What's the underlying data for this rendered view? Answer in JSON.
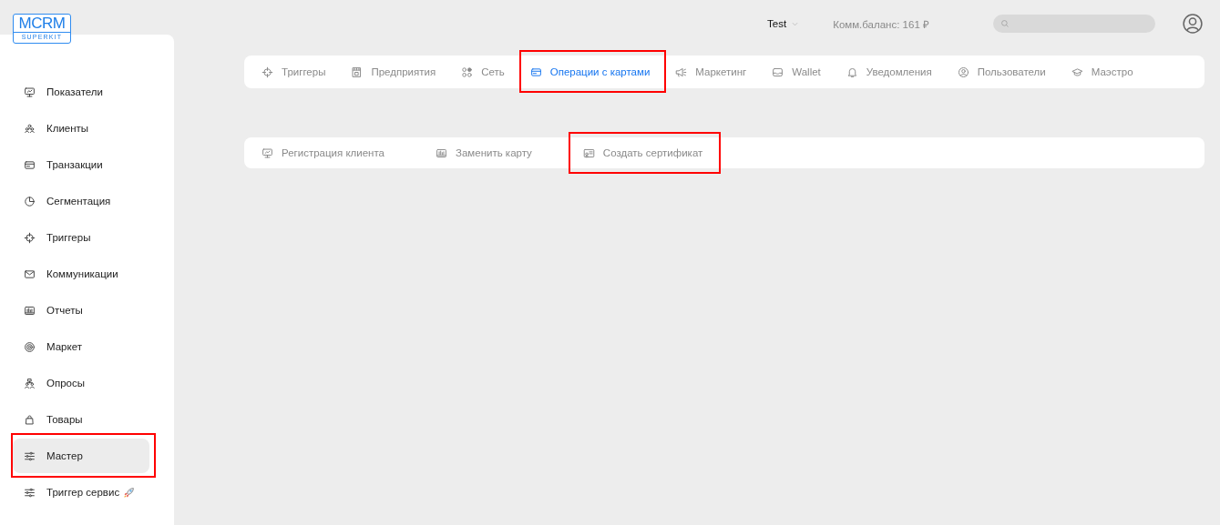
{
  "logo": {
    "title": "MCRM",
    "subtitle": "SUPERKIT"
  },
  "header": {
    "account": "Test",
    "balance": "Комм.баланс: 161 ₽"
  },
  "sidebar": {
    "items": [
      {
        "label": "Показатели",
        "selected": false,
        "highlighted": false
      },
      {
        "label": "Клиенты",
        "selected": false,
        "highlighted": false
      },
      {
        "label": "Транзакции",
        "selected": false,
        "highlighted": false
      },
      {
        "label": "Сегментация",
        "selected": false,
        "highlighted": false
      },
      {
        "label": "Триггеры",
        "selected": false,
        "highlighted": false
      },
      {
        "label": "Коммуникации",
        "selected": false,
        "highlighted": false
      },
      {
        "label": "Отчеты",
        "selected": false,
        "highlighted": false
      },
      {
        "label": "Маркет",
        "selected": false,
        "highlighted": false
      },
      {
        "label": "Опросы",
        "selected": false,
        "highlighted": false
      },
      {
        "label": "Товары",
        "selected": false,
        "highlighted": false
      },
      {
        "label": "Мастер",
        "selected": true,
        "highlighted": true
      },
      {
        "label": "Триггер сервис",
        "selected": false,
        "highlighted": false
      }
    ]
  },
  "tabs": [
    {
      "label": "Триггеры",
      "selected": false,
      "highlighted": false
    },
    {
      "label": "Предприятия",
      "selected": false,
      "highlighted": false
    },
    {
      "label": "Сеть",
      "selected": false,
      "highlighted": false
    },
    {
      "label": "Операции с картами",
      "selected": true,
      "highlighted": true
    },
    {
      "label": "Маркетинг",
      "selected": false,
      "highlighted": false
    },
    {
      "label": "Wallet",
      "selected": false,
      "highlighted": false
    },
    {
      "label": "Уведомления",
      "selected": false,
      "highlighted": false
    },
    {
      "label": "Пользователи",
      "selected": false,
      "highlighted": false
    },
    {
      "label": "Маэстро",
      "selected": false,
      "highlighted": false
    }
  ],
  "subtabs": [
    {
      "label": "Регистрация клиента",
      "highlighted": false
    },
    {
      "label": "Заменить карту",
      "highlighted": false
    },
    {
      "label": "Создать сертификат",
      "highlighted": true
    }
  ]
}
